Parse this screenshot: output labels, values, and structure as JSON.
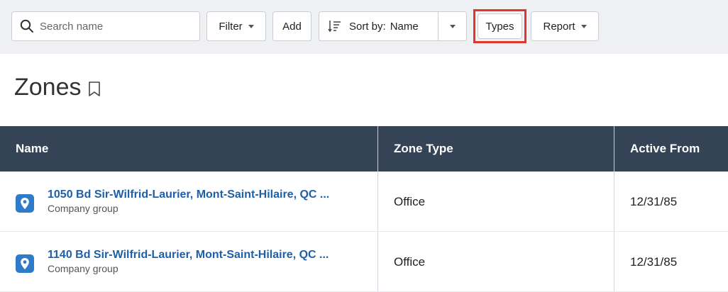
{
  "toolbar": {
    "search_placeholder": "Search name",
    "filter_label": "Filter",
    "add_label": "Add",
    "sort_prefix": "Sort by:",
    "sort_value": "Name",
    "types_label": "Types",
    "report_label": "Report",
    "highlight_color": "#e3352b"
  },
  "page": {
    "title": "Zones"
  },
  "table": {
    "columns": [
      "Name",
      "Zone Type",
      "Active From"
    ],
    "rows": [
      {
        "name": "1050 Bd Sir-Wilfrid-Laurier, Mont-Saint-Hilaire, QC ...",
        "group": "Company group",
        "zone_type": "Office",
        "active_from": "12/31/85",
        "icon": "location-pin-icon"
      },
      {
        "name": "1140 Bd Sir-Wilfrid-Laurier, Mont-Saint-Hilaire, QC ...",
        "group": "Company group",
        "zone_type": "Office",
        "active_from": "12/31/85",
        "icon": "location-pin-icon"
      }
    ]
  },
  "colors": {
    "header_bg": "#344356",
    "link": "#1f5fa8",
    "pin_bg": "#2f7bc9",
    "toolbar_bg": "#eef0f3"
  }
}
